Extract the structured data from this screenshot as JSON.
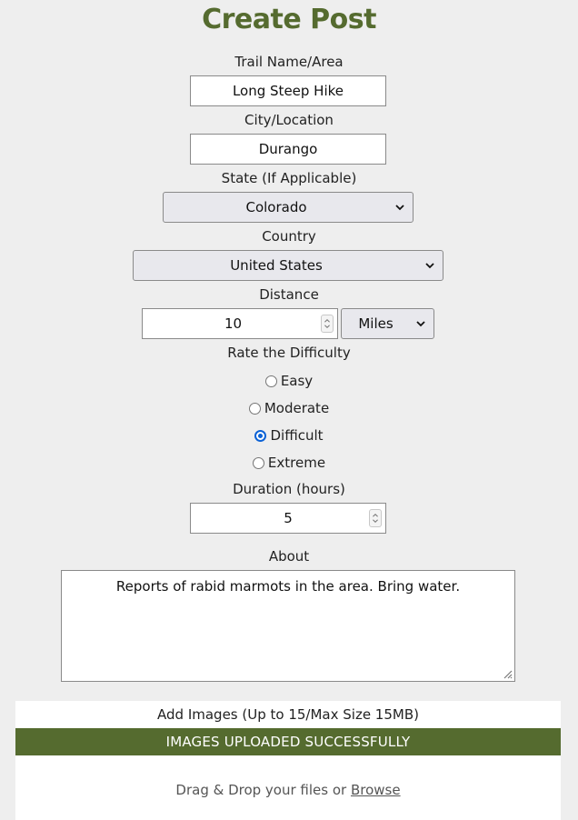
{
  "page": {
    "title": "Create Post"
  },
  "trail_name": {
    "label": "Trail Name/Area",
    "value": "Long Steep Hike"
  },
  "city": {
    "label": "City/Location",
    "value": "Durango"
  },
  "state": {
    "label": "State (If Applicable)",
    "selected": "Colorado"
  },
  "country": {
    "label": "Country",
    "selected": "United States"
  },
  "distance": {
    "label": "Distance",
    "value": "10",
    "unit_selected": "Miles"
  },
  "difficulty": {
    "label": "Rate the Difficulty",
    "options": [
      {
        "label": "Easy",
        "checked": false
      },
      {
        "label": "Moderate",
        "checked": false
      },
      {
        "label": "Difficult",
        "checked": true
      },
      {
        "label": "Extreme",
        "checked": false
      }
    ]
  },
  "duration": {
    "label": "Duration (hours)",
    "value": "5"
  },
  "about": {
    "label": "About",
    "value": "Reports of rabid marmots in the area. Bring water."
  },
  "upload": {
    "title": "Add Images (Up to 15/Max Size 15MB)",
    "status": "IMAGES UPLOADED SUCCESSFULLY",
    "drop_text": "Drag & Drop your files or ",
    "browse_label": "Browse"
  },
  "colors": {
    "accent": "#556b2f",
    "radio_checked": "#0b62d6"
  }
}
